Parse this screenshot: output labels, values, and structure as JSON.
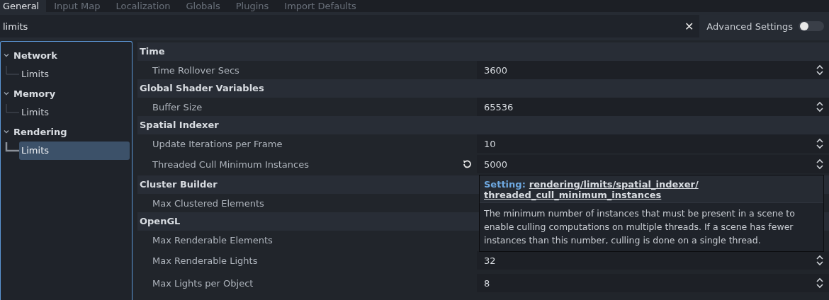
{
  "tabs": [
    {
      "label": "General",
      "selected": true
    },
    {
      "label": "Input Map",
      "selected": false
    },
    {
      "label": "Localization",
      "selected": false
    },
    {
      "label": "Globals",
      "selected": false
    },
    {
      "label": "Plugins",
      "selected": false
    },
    {
      "label": "Import Defaults",
      "selected": false
    }
  ],
  "search": {
    "value": "limits",
    "clear": "✕"
  },
  "advanced_settings": {
    "label": "Advanced Settings",
    "on": false
  },
  "tree": [
    {
      "label": "Network",
      "expanded": true,
      "children": [
        {
          "label": "Limits",
          "selected": false
        }
      ]
    },
    {
      "label": "Memory",
      "expanded": true,
      "children": [
        {
          "label": "Limits",
          "selected": false
        }
      ]
    },
    {
      "label": "Rendering",
      "expanded": true,
      "children": [
        {
          "label": "Limits",
          "selected": true
        }
      ]
    }
  ],
  "sections": [
    {
      "title": "Time",
      "properties": [
        {
          "name": "Time Rollover Secs",
          "value": "3600",
          "revertable": false
        }
      ]
    },
    {
      "title": "Global Shader Variables",
      "properties": [
        {
          "name": "Buffer Size",
          "value": "65536",
          "revertable": false
        }
      ]
    },
    {
      "title": "Spatial Indexer",
      "properties": [
        {
          "name": "Update Iterations per Frame",
          "value": "10",
          "revertable": false
        },
        {
          "name": "Threaded Cull Minimum Instances",
          "value": "5000",
          "revertable": true
        }
      ]
    },
    {
      "title": "Cluster Builder",
      "properties": [
        {
          "name": "Max Clustered Elements",
          "revertable": false
        }
      ]
    },
    {
      "title": "OpenGL",
      "properties": [
        {
          "name": "Max Renderable Elements",
          "revertable": false
        },
        {
          "name": "Max Renderable Lights",
          "value": "32",
          "revertable": false
        },
        {
          "name": "Max Lights per Object",
          "value": "8",
          "revertable": false
        }
      ]
    }
  ],
  "tooltip": {
    "label": "Setting:",
    "path_lines": [
      "rendering/limits/spatial_indexer/",
      "threaded_cull_minimum_instances"
    ],
    "description": "The minimum number of instances that must be present in a scene to enable culling computations on multiple threads. If a scene has fewer instances than this number, culling is done on a single thread."
  }
}
